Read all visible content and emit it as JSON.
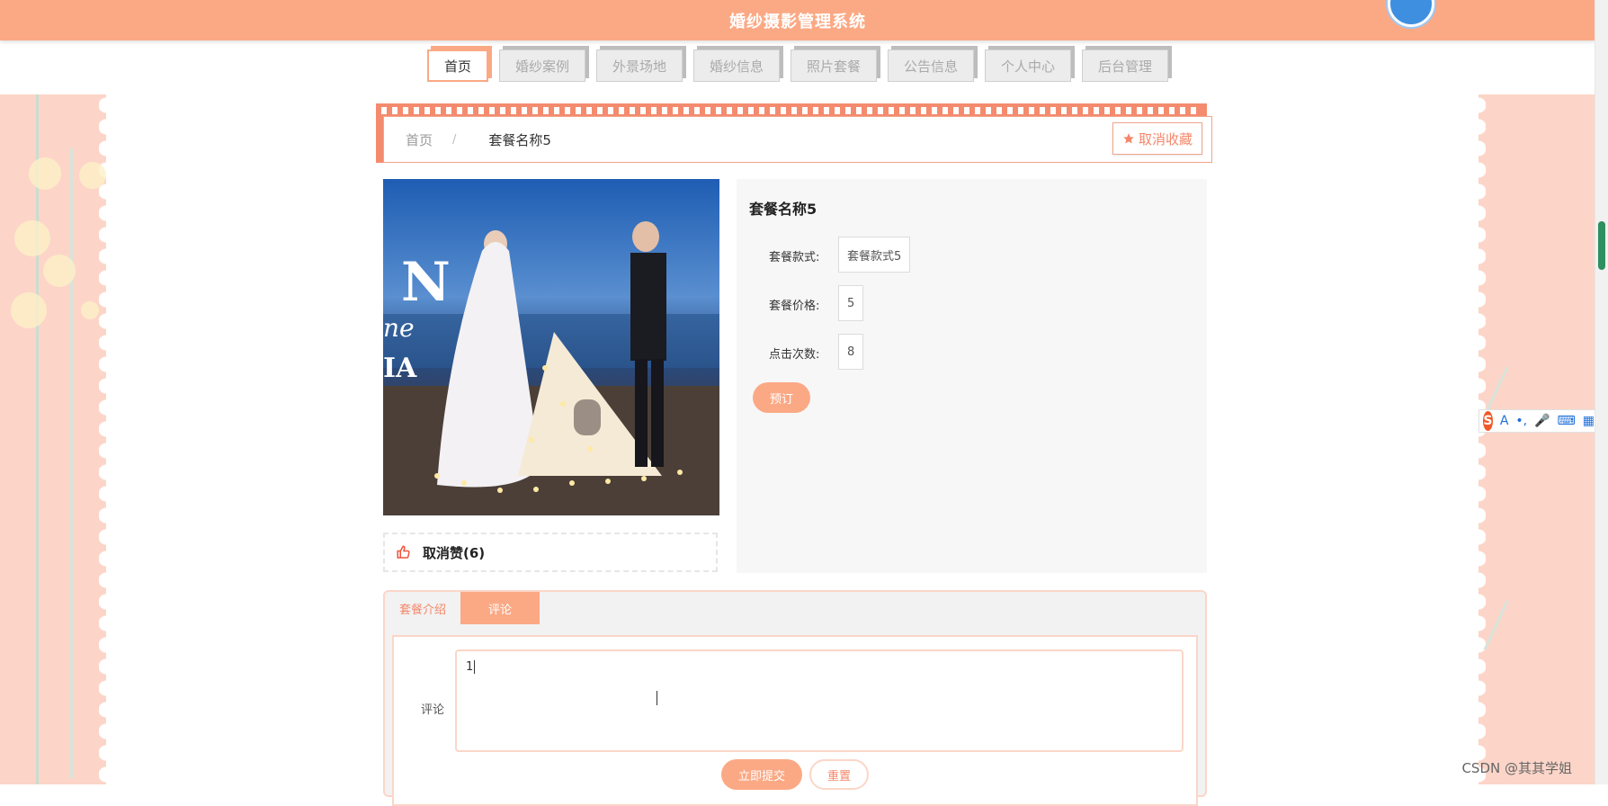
{
  "app": {
    "title": "婚纱摄影管理系统"
  },
  "nav": {
    "items": [
      {
        "label": "首页",
        "active": true
      },
      {
        "label": "婚纱案例",
        "active": false
      },
      {
        "label": "外景场地",
        "active": false
      },
      {
        "label": "婚纱信息",
        "active": false
      },
      {
        "label": "照片套餐",
        "active": false
      },
      {
        "label": "公告信息",
        "active": false
      },
      {
        "label": "个人中心",
        "active": false
      },
      {
        "label": "后台管理",
        "active": false
      }
    ]
  },
  "breadcrumb": {
    "home": "首页",
    "separator": "/",
    "current": "套餐名称5"
  },
  "favorite": {
    "label": "取消收藏",
    "icon": "star-icon"
  },
  "like": {
    "label": "取消赞(6)",
    "icon": "thumbs-up-icon"
  },
  "detail": {
    "title": "套餐名称5",
    "fields": [
      {
        "label": "套餐款式:",
        "value": "套餐款式5"
      },
      {
        "label": "套餐价格:",
        "value": "5"
      },
      {
        "label": "点击次数:",
        "value": "8"
      }
    ],
    "book_label": "预订"
  },
  "tabs": {
    "items": [
      "套餐介绍",
      "评论"
    ],
    "active_index": 1
  },
  "comment": {
    "label": "评论",
    "value": "1",
    "submit_label": "立即提交",
    "reset_label": "重置"
  },
  "ime": {
    "logo": "S",
    "items": [
      "A",
      "•,",
      "mic-icon",
      "keyboard-icon",
      "grid-icon"
    ]
  },
  "watermark": "CSDN @其其学姐",
  "colors": {
    "accent": "#fba985",
    "accent_dark": "#f4876a",
    "deco_bg": "#fcd5c8"
  }
}
